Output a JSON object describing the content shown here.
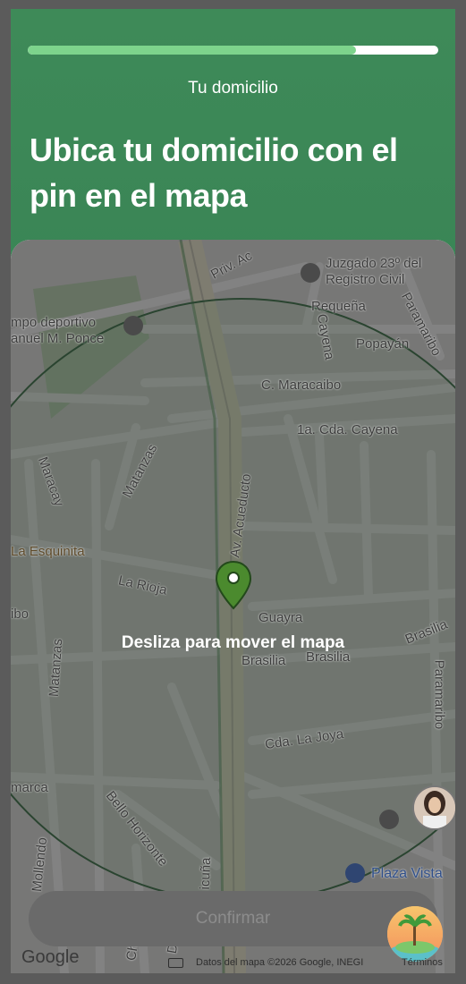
{
  "progress": {
    "fraction": 0.8
  },
  "header": {
    "step_label": "Tu domicilio",
    "title": "Ubica tu domicilio con el pin en el mapa"
  },
  "map": {
    "hint": "Desliza para mover el mapa",
    "labels": {
      "priv_ac": "Priv. Ac",
      "juzgado": "Juzgado 23º del",
      "registro": "Registro Civil",
      "campo1": "mpo deportivo",
      "campo2": "anuel M. Ponce",
      "requena": "Requeña",
      "paramaribo_top": "Paramaribo",
      "cayena": "Cayena",
      "popayan": "Popayán",
      "maracaibo": "C. Maracaibo",
      "cda_cayena": "1a. Cda. Cayena",
      "matanzas_top": "Matanzas",
      "maracay": "Maracay",
      "acueducto": "Av. Acueducto",
      "esquinita": "La Esquinita",
      "la_rioja": "La Rioja",
      "bo": "ibo",
      "guayra": "Guayra",
      "brasilia1": "Brasilia",
      "brasilia2": "Brasilia",
      "brasilia_right": "Brasilia",
      "paramaribo_right": "Paramaribo",
      "matanzas_left": "Matanzas",
      "cda_la_joya": "Cda. La Joya",
      "marca": "marca",
      "bello_horizonte": "Bello Horizonte",
      "mollendo": "Mollendo",
      "icuna": "icuña",
      "plaza_vista": "Plaza Vista",
      "chac": "Chac",
      "datos": "Datos"
    },
    "google_logo": "Google",
    "attribution": "Datos del mapa ©2026 Google, INEGI",
    "terms": "Términos"
  },
  "confirm_button": {
    "label": "Confirmar"
  },
  "colors": {
    "brand_green": "#3e8a58",
    "progress_fill": "#7dd48c",
    "pin": "#4b8a2e"
  },
  "icons": [
    "map-pin-icon",
    "avatar",
    "app-badge-icon"
  ]
}
